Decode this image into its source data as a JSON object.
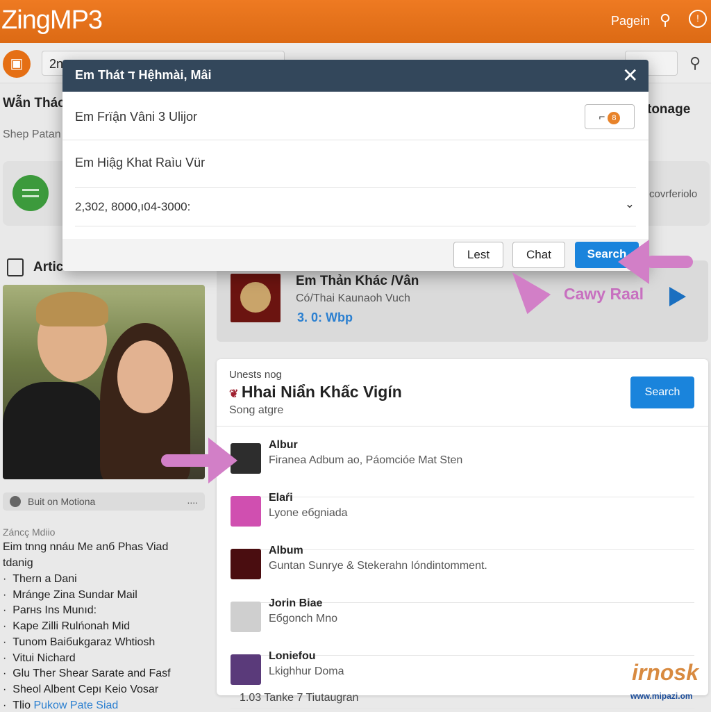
{
  "header": {
    "logo": "ZingMP3",
    "page_label": "Pagein",
    "icons": [
      "search-icon",
      "power-icon"
    ]
  },
  "toolbar": {
    "search_value": "2n",
    "icons": [
      "upload-icon",
      "key-icon"
    ]
  },
  "background": {
    "heading": "Wẫn Thác",
    "subheading": "Shep Patan",
    "right_heading": "tonage",
    "card_right_text": "covrferiolo"
  },
  "modal": {
    "title": "Em Thát ד Hệhmài, Mâi",
    "field1": "Em Frїận Vâni 3 Ulijor",
    "field2": "Em Hiậg Khat Raìu Vür",
    "select_value": "2,302, 8000,ı04-3000:",
    "buttons": {
      "lest": "Lest",
      "chat": "Chat",
      "search": "Search"
    }
  },
  "sidebar": {
    "section_title": "Artic...",
    "badge": "Buit on Motiona",
    "badge_more": "....",
    "label": "Záncç Mdiio",
    "text": "Eim tnng nnáu Me anб Phas Viad",
    "text2": "tdanig",
    "items": [
      "Thern a Dani",
      "Mrángе Zina Sundar Mail",
      "Parнs Ins Munıd:",
      "Kape Zilli Rulńonah Mid",
      "Tunom Baiбukgaraz Whtiosh",
      "Vitui Nichard",
      "Glu Ther Shear Sarate and Fasf",
      "Sheol Albent Cepı Keio Vosar"
    ],
    "last_item_prefix": "Tlio",
    "last_item_link": "Pukow Pate Siad"
  },
  "now_playing": {
    "title": "Em Thản Khác /Vân",
    "subtitle": "Có/Thai Kaunaoh Vuch",
    "meta": "3. 0: Wbp",
    "tag": "Cawy Raal"
  },
  "songs": {
    "kicker": "Unests nog",
    "title": "Hhai Niẩn Khấc Vigín",
    "subtitle": "Song atgre",
    "search_button": "Search",
    "items": [
      {
        "title": "Albur",
        "subtitle": "Firanea Adbum ao, Páomcióe Mat Sten",
        "color": "#2d2d2d"
      },
      {
        "title": "Elaŕi",
        "subtitle": "Lyone eбgniada",
        "color": "#d04fb0"
      },
      {
        "title": "Album",
        "subtitle": "Guntan Sunrye & Stekerahn Ióndintomment.",
        "color": "#4a0d10"
      },
      {
        "title": "Jorin Biae",
        "subtitle": "Eбgonch Mno",
        "color": "#cfcfcf"
      },
      {
        "title": "Loniefou",
        "subtitle": "Lkighhur Doma",
        "color": "#5a3a7a"
      }
    ]
  },
  "footer": {
    "text": "1.03 Tanke 7 Tiutaugran"
  },
  "watermark": {
    "logo": "irnosk",
    "url": "www.mipazi.om"
  },
  "colors": {
    "brand": "#e8731c",
    "modal_header": "#33475b",
    "accent": "#1a84dc",
    "annotation": "#d27fc7"
  }
}
